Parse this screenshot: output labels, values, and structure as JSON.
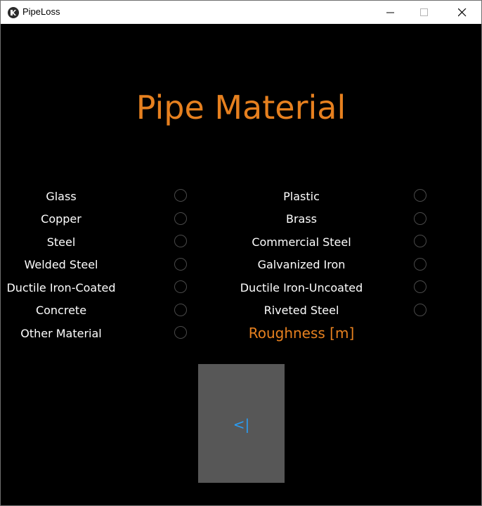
{
  "window": {
    "title": "PipeLoss"
  },
  "heading": "Pipe Material",
  "materials": {
    "left": [
      "Glass",
      "Copper",
      "Steel",
      "Welded Steel",
      "Ductile Iron-Coated",
      "Concrete",
      "Other Material"
    ],
    "right": [
      "Plastic",
      "Brass",
      "Commercial Steel",
      "Galvanized Iron",
      "Ductile Iron-Uncoated",
      "Riveted Steel"
    ]
  },
  "roughness_label": "Roughness [m]",
  "back_button": {
    "label": "<|"
  },
  "colors": {
    "accent": "#e6801f",
    "back_label": "#2a9df4",
    "button_bg": "#575757"
  }
}
